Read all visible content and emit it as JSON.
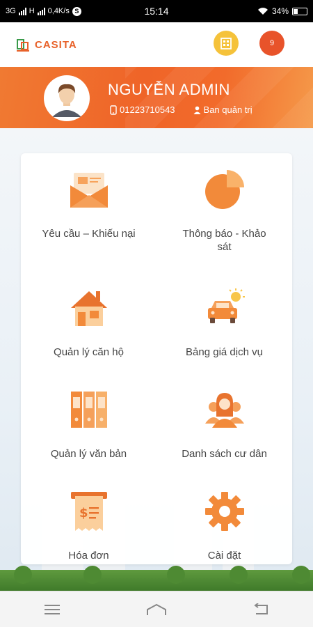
{
  "status_bar": {
    "network_left": "3G",
    "network_h": "H",
    "speed": "0,4K/s",
    "skype_glyph": "S",
    "time": "15:14",
    "battery": "34%",
    "icons": [
      "signal-icon",
      "skype-icon",
      "wifi-icon",
      "battery-icon"
    ]
  },
  "app": {
    "logo_text": "CASITA",
    "notification_count": "9",
    "brand_color": "#e8622a",
    "accent_yellow": "#f5c23a"
  },
  "profile": {
    "name": "NGUYỄN ADMIN",
    "phone": "01223710543",
    "role": "Ban quản trị",
    "banner_color": "#ef6428"
  },
  "menu": [
    {
      "label": "Yêu cầu – Khiếu nại",
      "icon": "envelope-icon"
    },
    {
      "label": "Thông báo - Khảo sát",
      "icon": "pie-chart-icon"
    },
    {
      "label": "Quản lý căn hộ",
      "icon": "house-icon"
    },
    {
      "label": "Bảng giá dịch vụ",
      "icon": "car-icon"
    },
    {
      "label": "Quản lý văn bản",
      "icon": "binders-icon"
    },
    {
      "label": "Danh sách cư dân",
      "icon": "residents-icon"
    },
    {
      "label": "Hóa đơn",
      "icon": "invoice-icon"
    },
    {
      "label": "Cài đặt",
      "icon": "gear-icon"
    }
  ],
  "nav": {
    "icons": [
      "menu-icon",
      "home-icon",
      "back-icon"
    ]
  }
}
